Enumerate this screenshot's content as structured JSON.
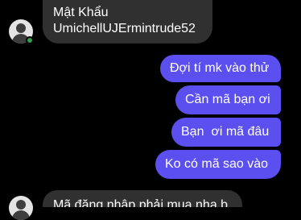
{
  "conversation": {
    "incoming_1": {
      "line1": "Mật Khẩu",
      "line2": "UmichellUJErmintrude52"
    },
    "outgoing": [
      "Đợi tí mk vào thử",
      "Cần mã bạn ơi",
      "Bạn  ơi mã đâu",
      "Ko có mã sao vào"
    ],
    "incoming_2": {
      "text": "Mã đăng nhập phải mua nha b"
    },
    "colors": {
      "background": "#000000",
      "incoming_bubble": "#303030",
      "outgoing_bubble": "#5b4ff0",
      "online": "#31a24c"
    }
  }
}
